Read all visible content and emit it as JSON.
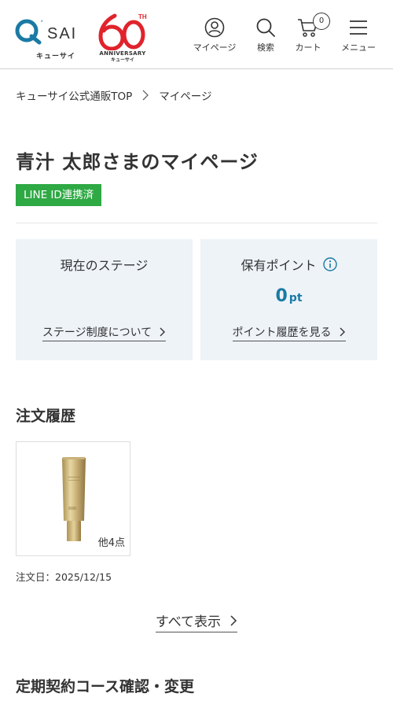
{
  "header": {
    "logo_text": "Q'SAI",
    "logo_sub": "キューサイ",
    "anniversary_number": "60",
    "anniversary_sup": "TH",
    "anniversary_text": "ANNIVERSARY",
    "anniversary_sub": "キューサイ",
    "nav": [
      {
        "label": "マイページ",
        "icon": "user-icon"
      },
      {
        "label": "検索",
        "icon": "search-icon"
      },
      {
        "label": "カート",
        "icon": "cart-icon",
        "badge": "0"
      },
      {
        "label": "メニュー",
        "icon": "hamburger-menu-icon"
      }
    ],
    "colors": {
      "brand_blue": "#1a7aa4",
      "brand_red": "#e0232c"
    }
  },
  "breadcrumb": [
    {
      "label": "キューサイ公式通販TOP"
    },
    {
      "label": "マイページ"
    }
  ],
  "page_title": "青汁 太郎さまのマイページ",
  "line_badge": {
    "label": "LINE ID連携済",
    "color": "#2ea944"
  },
  "stage_panel": {
    "title": "現在のステージ",
    "link": "ステージ制度について"
  },
  "points_panel": {
    "title": "保有ポイント",
    "value": "0",
    "unit": "pt",
    "link": "ポイント履歴を見る"
  },
  "orders": {
    "title": "注文履歴",
    "items": [
      {
        "more": "他4点",
        "date_label": "注文日：2025/12/15"
      }
    ],
    "show_all": "すべて表示"
  },
  "subscription": {
    "title": "定期契約コース確認・変更"
  }
}
